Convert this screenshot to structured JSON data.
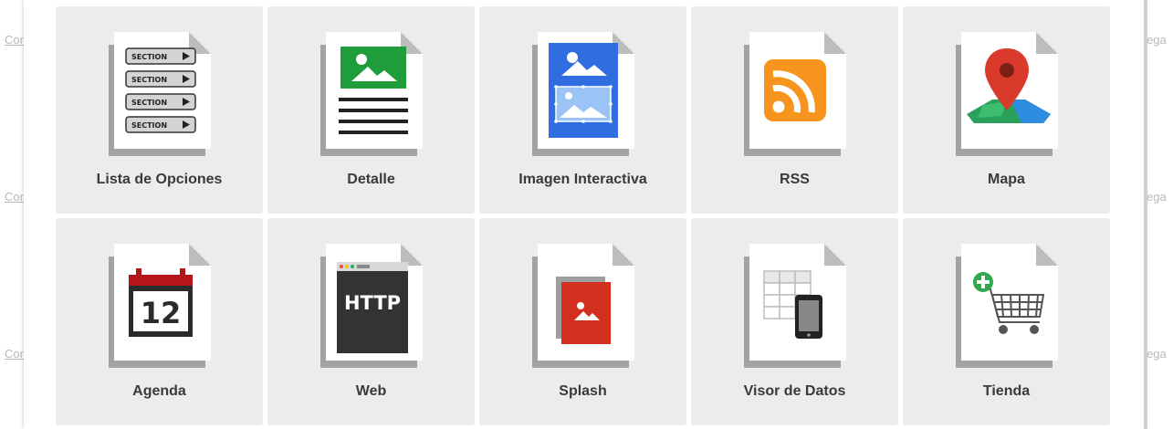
{
  "background": {
    "left_edge_texts": [
      "Cor",
      "Cor",
      "Cor"
    ],
    "right_edge_texts": [
      "ega",
      "ega",
      "ega"
    ]
  },
  "colors": {
    "tile_background": "#ececec",
    "label_color": "#3a3a3a",
    "rss_orange": "#f7941d",
    "map_pin_red": "#d93a2b",
    "image_blue": "#2f6de1",
    "detail_green": "#1f9d3a",
    "calendar_red": "#b5161b",
    "splash_red": "#d32f1e",
    "store_plus_green": "#2fa84f"
  },
  "options": [
    {
      "label": "Lista de Opciones",
      "icon": "section-list-icon",
      "section_label": "SECTION"
    },
    {
      "label": "Detalle",
      "icon": "detail-page-icon"
    },
    {
      "label": "Imagen Interactiva",
      "icon": "interactive-image-icon"
    },
    {
      "label": "RSS",
      "icon": "rss-feed-icon"
    },
    {
      "label": "Mapa",
      "icon": "map-pin-icon"
    },
    {
      "label": "Agenda",
      "icon": "calendar-icon",
      "calendar_day": "12"
    },
    {
      "label": "Web",
      "icon": "web-http-icon",
      "http_text": "HTTP"
    },
    {
      "label": "Splash",
      "icon": "splash-image-icon"
    },
    {
      "label": "Visor de Datos",
      "icon": "data-viewer-icon"
    },
    {
      "label": "Tienda",
      "icon": "store-cart-icon"
    }
  ]
}
